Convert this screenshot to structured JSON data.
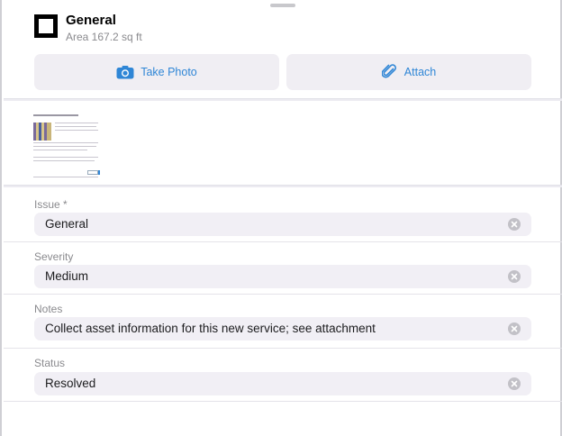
{
  "header": {
    "icon": "square-outline-icon",
    "title": "General",
    "subtitle": "Area 167.2 sq ft"
  },
  "actions": {
    "take_photo": {
      "label": "Take Photo",
      "icon": "camera-icon"
    },
    "attach": {
      "label": "Attach",
      "icon": "paperclip-icon"
    }
  },
  "attachment": {
    "icon": "document-thumbnail"
  },
  "fields": [
    {
      "label": "Issue *",
      "value": "General"
    },
    {
      "label": "Severity",
      "value": "Medium"
    },
    {
      "label": "Notes",
      "value": "Collect asset information for this new service; see attachment"
    },
    {
      "label": "Status",
      "value": "Resolved"
    }
  ],
  "colors": {
    "accent": "#2f86d6",
    "field_bg": "#f1eff5",
    "label": "#8a8a8e"
  }
}
